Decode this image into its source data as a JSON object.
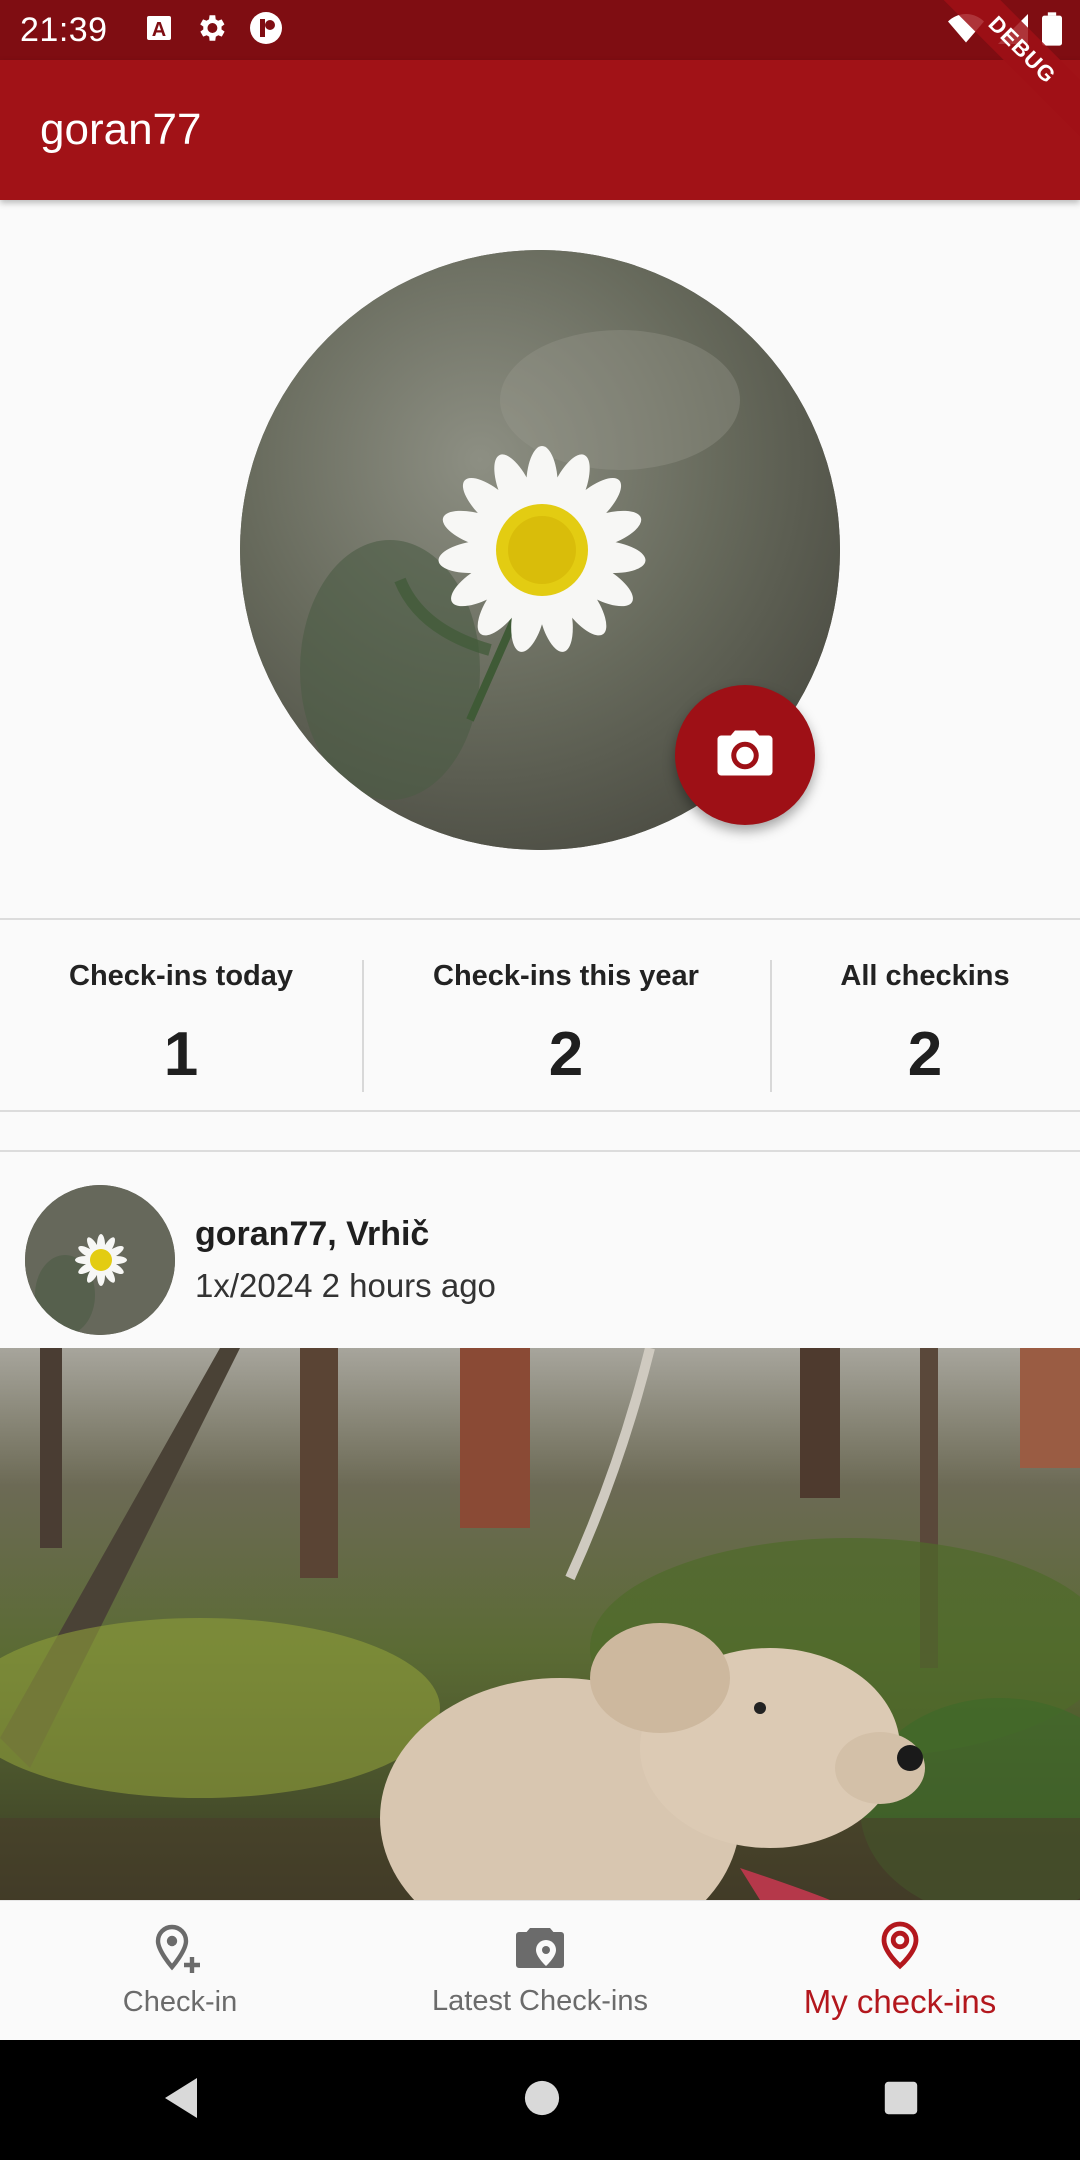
{
  "status_bar": {
    "time": "21:39",
    "icons_left": [
      "font-a-icon",
      "gear-icon",
      "app-badge-icon"
    ],
    "icons_right": [
      "wifi-icon",
      "signal-icon",
      "battery-icon"
    ],
    "debug_banner": "DEBUG"
  },
  "app_bar": {
    "title": "goran77"
  },
  "profile": {
    "avatar_icon": "camera-icon"
  },
  "stats": [
    {
      "label": "Check-ins today",
      "value": "1"
    },
    {
      "label": "Check-ins this year",
      "value": "2"
    },
    {
      "label": "All checkins",
      "value": "2"
    }
  ],
  "feed": {
    "items": [
      {
        "title": "goran77, Vrhič",
        "subtitle": "1x/2024 2 hours ago"
      }
    ]
  },
  "bottom_nav": {
    "items": [
      {
        "label": "Check-in",
        "icon": "location-add-icon",
        "active": false
      },
      {
        "label": "Latest Check-ins",
        "icon": "camera-location-icon",
        "active": false
      },
      {
        "label": "My check-ins",
        "icon": "location-pin-icon",
        "active": true
      }
    ]
  },
  "colors": {
    "primary": "#a11217",
    "status_bar": "#7f0d12",
    "active_nav": "#b3171d"
  }
}
